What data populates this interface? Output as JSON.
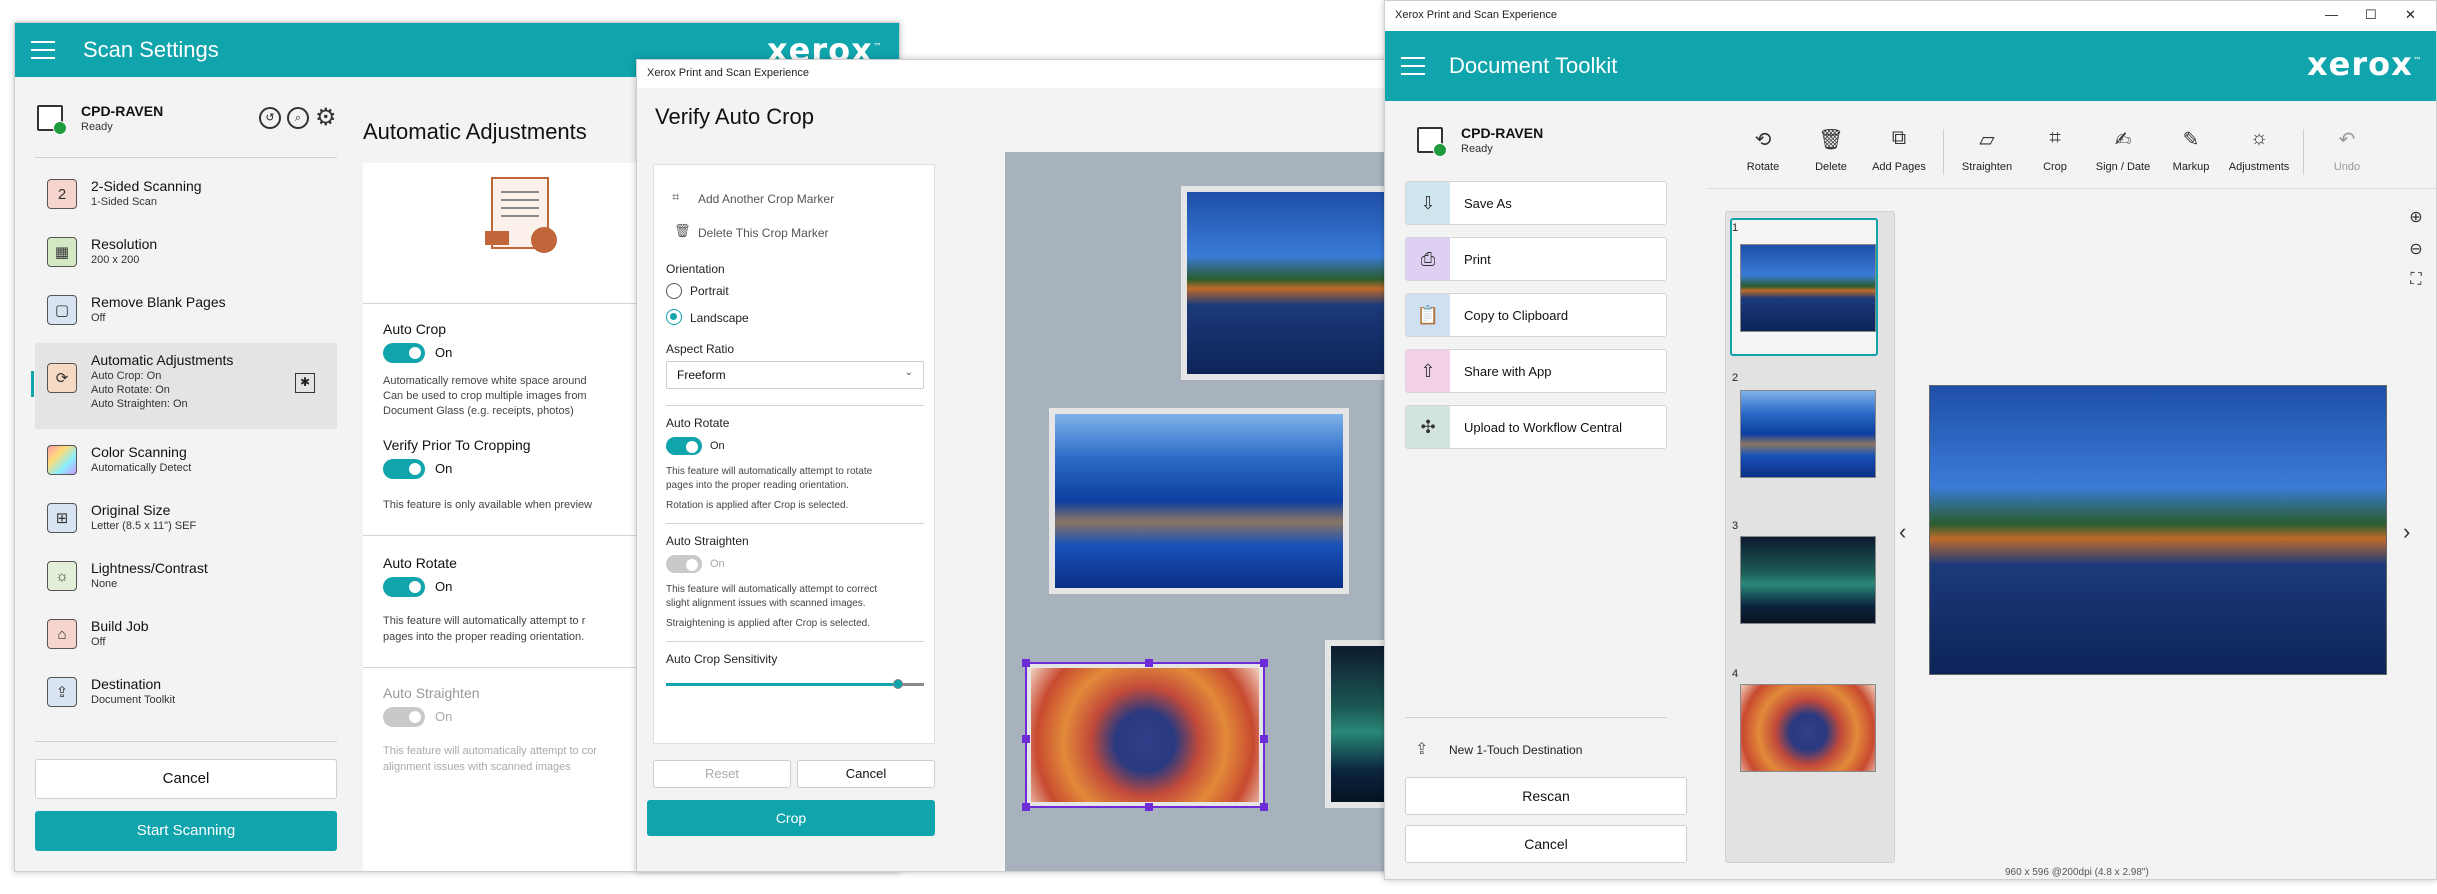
{
  "scan_settings": {
    "title": "Scan Settings",
    "brand": "xerox",
    "device": {
      "name": "CPD-RAVEN",
      "status": "Ready"
    },
    "items": [
      {
        "title": "2-Sided Scanning",
        "lines": [
          "1-Sided Scan"
        ]
      },
      {
        "title": "Resolution",
        "lines": [
          "200 x 200"
        ]
      },
      {
        "title": "Remove Blank Pages",
        "lines": [
          "Off"
        ]
      },
      {
        "title": "Automatic Adjustments",
        "lines": [
          "Auto Crop: On",
          "Auto Rotate: On",
          "Auto Straighten: On"
        ]
      },
      {
        "title": "Color Scanning",
        "lines": [
          "Automatically Detect"
        ]
      },
      {
        "title": "Original Size",
        "lines": [
          "Letter (8.5 x 11\") SEF"
        ]
      },
      {
        "title": "Lightness/Contrast",
        "lines": [
          "None"
        ]
      },
      {
        "title": "Build Job",
        "lines": [
          "Off"
        ]
      },
      {
        "title": "Destination",
        "lines": [
          "Document Toolkit"
        ]
      }
    ],
    "cancel": "Cancel",
    "start": "Start Scanning",
    "panel": {
      "title": "Automatic Adjustments",
      "auto_crop": "Auto Crop",
      "on": "On",
      "auto_crop_desc": [
        "Automatically remove white space around",
        "Can be used to crop multiple images from",
        "Document Glass (e.g. receipts, photos)"
      ],
      "verify_prior": "Verify Prior To Cropping",
      "preview_note": "This feature is only available when preview",
      "auto_rotate": "Auto Rotate",
      "auto_rotate_desc": [
        "This feature will automatically attempt to r",
        "pages into the proper reading orientation."
      ],
      "auto_straighten": "Auto Straighten",
      "auto_straighten_desc": [
        "This feature will automatically attempt to cor",
        "alignment issues with scanned images"
      ]
    }
  },
  "verify": {
    "window_title": "Xerox Print and Scan Experience",
    "title": "Verify Auto Crop",
    "add_marker": "Add Another Crop Marker",
    "delete_marker": "Delete This Crop Marker",
    "orientation": "Orientation",
    "portrait": "Portrait",
    "landscape": "Landscape",
    "aspect_ratio": "Aspect Ratio",
    "aspect_value": "Freeform",
    "auto_rotate": "Auto Rotate",
    "on": "On",
    "rotate_desc": [
      "This feature will automatically attempt to rotate",
      "pages into the proper reading orientation."
    ],
    "rotate_note": "Rotation is applied after Crop is selected.",
    "auto_straighten": "Auto Straighten",
    "straighten_desc": [
      "This feature will automatically attempt to correct",
      "slight alignment issues with scanned images."
    ],
    "straighten_note": "Straightening is applied after Crop is selected.",
    "sensitivity": "Auto Crop Sensitivity",
    "sensitivity_value": 0.9,
    "reset": "Reset",
    "cancel": "Cancel",
    "crop": "Crop"
  },
  "toolkit": {
    "window_title": "Xerox Print and Scan Experience",
    "title": "Document Toolkit",
    "brand": "xerox",
    "device": {
      "name": "CPD-RAVEN",
      "status": "Ready"
    },
    "actions": [
      "Save As",
      "Print",
      "Copy to Clipboard",
      "Share with App",
      "Upload to Workflow Central"
    ],
    "new_destination": "New 1-Touch Destination",
    "rescan": "Rescan",
    "cancel": "Cancel",
    "tools": [
      "Rotate",
      "Delete",
      "Add Pages",
      "Straighten",
      "Crop",
      "Sign / Date",
      "Markup",
      "Adjustments",
      "Undo"
    ],
    "pages": [
      "1",
      "2",
      "3",
      "4"
    ],
    "status": "960 x 596 @200dpi (4.8 x 2.98\")"
  },
  "colors": {
    "accent": "#10a4ad",
    "crop_marker": "#6e2bd8",
    "ready": "#1e9b3e"
  }
}
